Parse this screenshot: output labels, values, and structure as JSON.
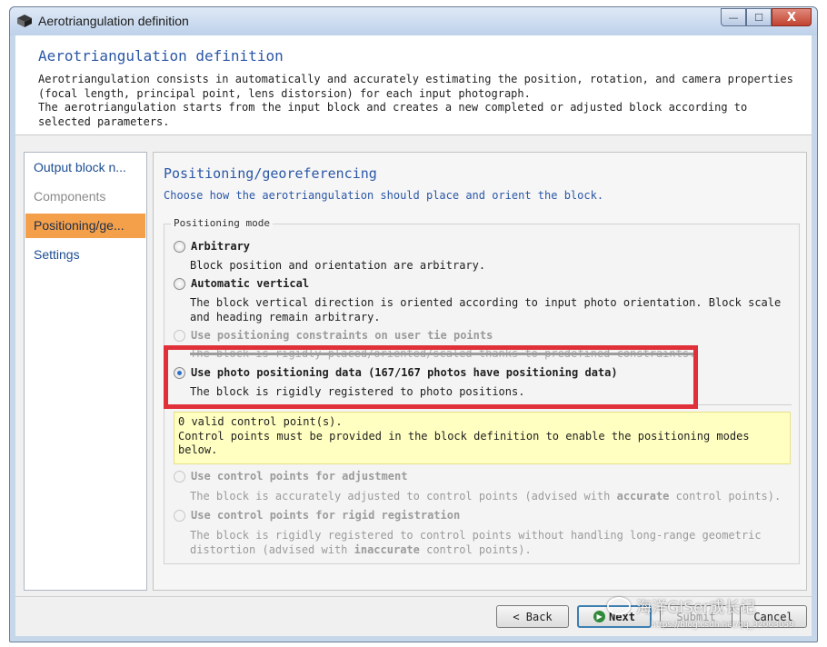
{
  "window": {
    "title": "Aerotriangulation definition",
    "buttons": {
      "minimize": "—",
      "maximize": "☐",
      "close": "X"
    }
  },
  "header": {
    "title": "Aerotriangulation definition",
    "description": "Aerotriangulation consists in automatically and accurately estimating the position, rotation, and camera properties (focal length, principal point, lens distorsion) for each input photograph.\nThe aerotriangulation starts from the input block and creates a new completed or adjusted block according to selected parameters."
  },
  "sidebar": {
    "items": [
      {
        "label": "Output block n...",
        "state": "normal"
      },
      {
        "label": "Components",
        "state": "disabled"
      },
      {
        "label": "Positioning/ge...",
        "state": "active"
      },
      {
        "label": "Settings",
        "state": "normal"
      }
    ]
  },
  "panel": {
    "title": "Positioning/georeferencing",
    "subtitle": "Choose how the aerotriangulation should place and orient the block.",
    "group_label": "Positioning mode",
    "options": [
      {
        "label": "Arbitrary",
        "desc": "Block position and orientation are arbitrary.",
        "checked": false,
        "enabled": true
      },
      {
        "label": "Automatic vertical",
        "desc": "The block vertical direction is oriented according to input photo orientation. Block scale and heading remain arbitrary.",
        "checked": false,
        "enabled": true
      },
      {
        "label": "Use positioning constraints on user tie points",
        "desc": "The block is rigidly placed/oriented/scaled thanks to predefined constraints.",
        "checked": false,
        "enabled": false
      },
      {
        "label": "Use photo positioning data (167/167 photos have positioning data)",
        "desc": "The block is rigidly registered to photo positions.",
        "checked": true,
        "enabled": true
      }
    ],
    "warning": {
      "line1": "0 valid control point(s).",
      "line2": "Control points must be provided in the block definition to enable the positioning modes below."
    },
    "control_options": [
      {
        "label": "Use control points for adjustment",
        "desc_before": "The block is accurately adjusted to control points (advised with ",
        "desc_bold": "accurate",
        "desc_after": " control points).",
        "enabled": false
      },
      {
        "label": "Use control points for rigid registration",
        "desc_before": "The block is rigidly registered to control points without handling long-range geometric distortion (advised with ",
        "desc_bold": "inaccurate",
        "desc_after": " control points).",
        "enabled": false
      }
    ]
  },
  "footer": {
    "back_label": "< Back",
    "next_label": "Next",
    "submit_label": "Submit",
    "cancel_label": "Cancel"
  },
  "watermark": {
    "text": "海洋GISer成长记",
    "url": "https://blog.csdn.net/qq_32063059"
  },
  "colors": {
    "accent": "#2b57a6",
    "active_nav": "#f4a04a",
    "warning_bg": "#ffffc2",
    "highlight": "#e0303a"
  }
}
